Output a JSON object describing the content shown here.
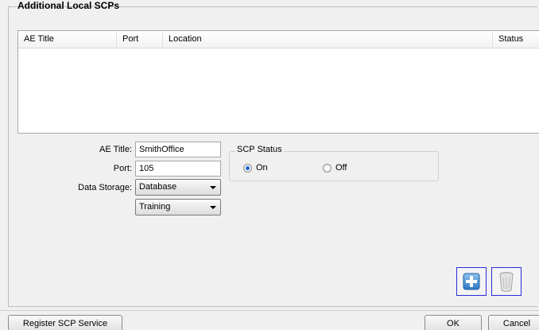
{
  "group": {
    "title": "Additional Local SCPs"
  },
  "table": {
    "columns": [
      "AE Title",
      "Port",
      "Location",
      "Status"
    ],
    "rows": []
  },
  "form": {
    "ae_title_label": "AE Title:",
    "ae_title_value": "SmithOffice",
    "port_label": "Port:",
    "port_value": "105",
    "data_storage_label": "Data Storage:",
    "data_storage_value": "Database",
    "database_value": "Training"
  },
  "scp_status": {
    "title": "SCP Status",
    "on_label": "On",
    "off_label": "Off",
    "selected": "On"
  },
  "toolbar": {
    "add_icon": "plus-icon",
    "delete_icon": "trash-icon"
  },
  "footer": {
    "register_label": "Register SCP Service",
    "ok_label": "OK",
    "cancel_label": "Cancel"
  },
  "colors": {
    "accent": "#1b65d4",
    "icon_border": "#2b2bd8"
  }
}
